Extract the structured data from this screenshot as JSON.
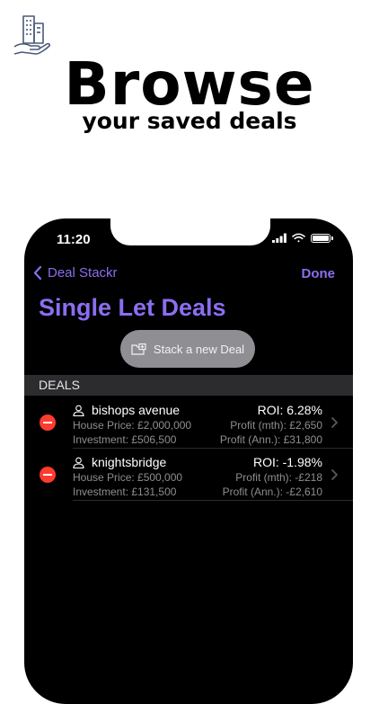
{
  "promo": {
    "headline": "Browse",
    "subheadline": "your saved deals",
    "logo_icon": "building-in-hand-icon"
  },
  "status_bar": {
    "time": "11:20",
    "icons": [
      "signal-icon",
      "wifi-icon",
      "battery-icon"
    ]
  },
  "nav": {
    "back_label": "Deal Stackr",
    "done_label": "Done"
  },
  "page": {
    "title": "Single Let Deals",
    "stack_button_label": "Stack a new Deal"
  },
  "deals_section": {
    "header": "DEALS",
    "items": [
      {
        "name": "bishops avenue",
        "house_price": "House Price: £2,000,000",
        "investment": "Investment: £506,500",
        "roi": "ROI: 6.28%",
        "profit_month": "Profit (mth): £2,650",
        "profit_annual": "Profit (Ann.): £31,800"
      },
      {
        "name": "knightsbridge",
        "house_price": "House Price: £500,000",
        "investment": "Investment: £131,500",
        "roi": "ROI: -1.98%",
        "profit_month": "Profit (mth): -£218",
        "profit_annual": "Profit (Ann.): -£2,610"
      }
    ]
  },
  "colors": {
    "accent": "#8b6ef0",
    "delete": "#ff3b30",
    "secondary_text": "#8e8e93",
    "section_header_bg": "#2c2c2e"
  }
}
